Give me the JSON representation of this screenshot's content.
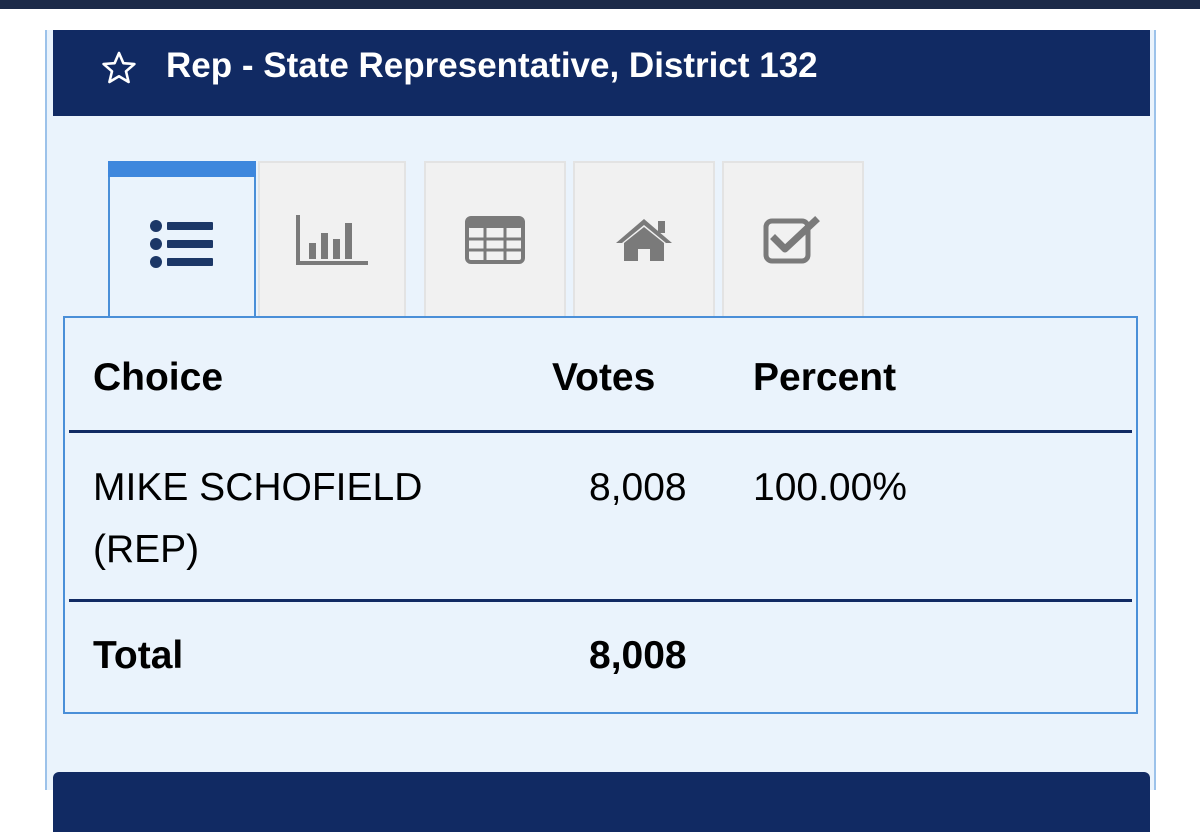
{
  "header": {
    "title": "Rep - State Representative, District 132"
  },
  "tabs": [
    {
      "name": "list-view",
      "icon": "list-icon",
      "active": true
    },
    {
      "name": "chart-view",
      "icon": "bar-chart-icon",
      "active": false
    },
    {
      "name": "table-view",
      "icon": "table-grid-icon",
      "active": false
    },
    {
      "name": "precinct-view",
      "icon": "home-icon",
      "active": false
    },
    {
      "name": "ballot-view",
      "icon": "checkbox-icon",
      "active": false
    }
  ],
  "results": {
    "columns": {
      "choice": "Choice",
      "votes": "Votes",
      "percent": "Percent"
    },
    "rows": [
      {
        "choice_line1": "MIKE SCHOFIELD",
        "choice_line2": "(REP)",
        "votes": "8,008",
        "percent": "100.00%"
      }
    ],
    "total": {
      "label": "Total",
      "votes": "8,008"
    }
  },
  "colors": {
    "header_bg": "#112a63",
    "panel_bg": "#eaf3fc",
    "accent": "#3e87dd",
    "icon_active": "#1c3767",
    "icon_inactive": "#7a7a7a"
  }
}
